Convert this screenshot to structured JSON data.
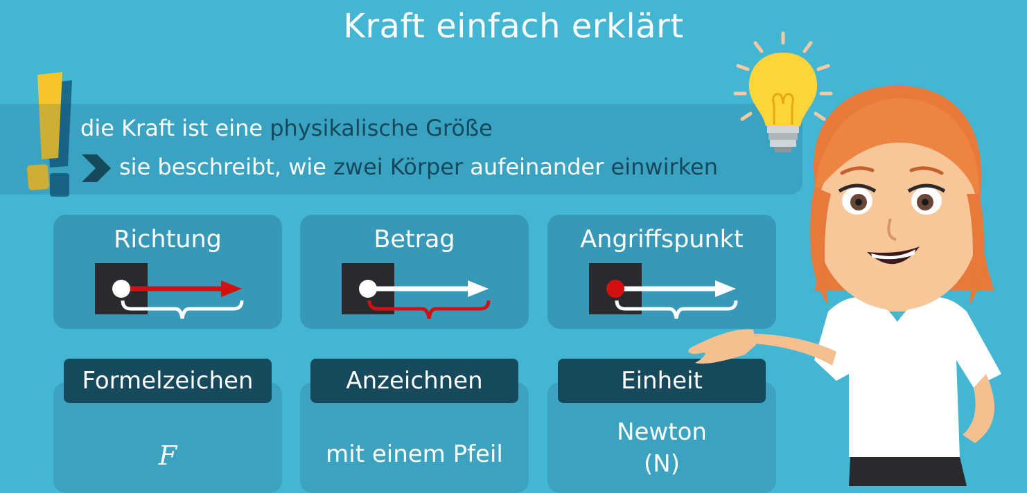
{
  "title": "Kraft einfach erklärt",
  "definition": {
    "line1_part1": "die Kraft ist eine ",
    "line1_highlight": "physikalische Größe",
    "line2_part1": "sie beschreibt, wie ",
    "line2_highlight1": "zwei Körper",
    "line2_part2": " aufeinander ",
    "line2_highlight2": "einwirken"
  },
  "properties": [
    {
      "label": "Richtung"
    },
    {
      "label": "Betrag"
    },
    {
      "label": "Angriffspunkt"
    }
  ],
  "details": [
    {
      "heading": "Formelzeichen",
      "value": "F"
    },
    {
      "heading": "Anzeichnen",
      "value": "mit einem Pfeil"
    },
    {
      "heading": "Einheit",
      "value_line1": "Newton",
      "value_line2": "(N)"
    }
  ],
  "colors": {
    "background": "#43b6d4",
    "accent_dark": "#17495c",
    "highlight_text": "#15485a",
    "exclamation": "#f7c52a",
    "arrow_red": "#d41010"
  },
  "icons": [
    "exclamation-icon",
    "chevron-right-icon",
    "lightbulb-icon"
  ]
}
